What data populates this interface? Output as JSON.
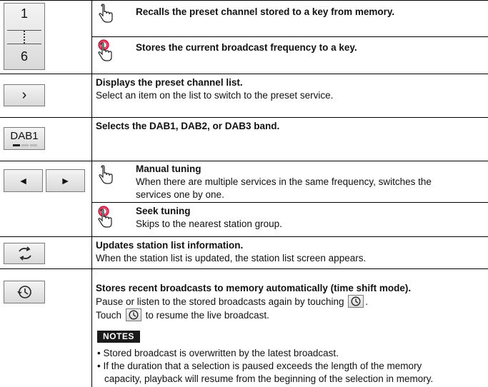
{
  "preset": {
    "key_top": "1",
    "key_bottom": "6",
    "recall_text": "Recalls the preset channel stored to a key from memory.",
    "store_text": "Stores the current broadcast frequency to a key."
  },
  "list": {
    "button_glyph": "›",
    "title": "Displays the preset channel list.",
    "desc": "Select an item on the list to switch to the preset service."
  },
  "band": {
    "button_label": "DAB1",
    "title": "Selects the DAB1, DAB2, or DAB3 band."
  },
  "tuning": {
    "left_glyph": "◄",
    "right_glyph": "►",
    "manual_title": "Manual tuning",
    "manual_desc_1": "When there are multiple services in the same frequency, switches the",
    "manual_desc_2": "services one by one.",
    "seek_title": "Seek tuning",
    "seek_desc": "Skips to the nearest station group."
  },
  "update": {
    "title": "Updates station list information.",
    "desc": "When the station list is updated, the station list screen appears."
  },
  "timeshift": {
    "title": "Stores recent broadcasts to memory automatically (time shift mode).",
    "desc_1": "Pause or listen to the stored broadcasts again by touching",
    "desc_2_pre": "Touch",
    "desc_2_post": "to resume the live broadcast.",
    "notes_label": "NOTES",
    "note_1": "Stored broadcast is overwritten by the latest broadcast.",
    "note_2a": "If the duration that a selection is paused exceeds the length of the memory",
    "note_2b": "capacity, playback will resume from the beginning of the selection in memory."
  },
  "icons": {
    "touch": "touch-hand-icon",
    "hold": "touch-hold-icon",
    "refresh": "refresh-icon",
    "timeshift": "timeshift-icon"
  }
}
